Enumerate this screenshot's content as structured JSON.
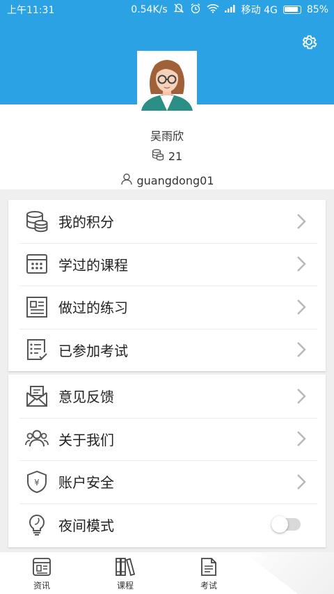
{
  "status_bar": {
    "time": "上午11:31",
    "speed": "0.54K/s",
    "carrier": "移动 4G",
    "battery": "85%"
  },
  "colors": {
    "primary": "#2aa2e3",
    "icon": "#555555",
    "chevron": "#b8b8b8"
  },
  "profile": {
    "name": "吴雨欣",
    "points": "21",
    "username": "guangdong01"
  },
  "menu_group1": [
    {
      "label": "我的积分",
      "icon": "coins-icon"
    },
    {
      "label": "学过的课程",
      "icon": "calendar-grid-icon"
    },
    {
      "label": "做过的练习",
      "icon": "newspaper-icon"
    },
    {
      "label": "已参加考试",
      "icon": "checklist-icon"
    }
  ],
  "menu_group2": [
    {
      "label": "意见反馈",
      "icon": "envelope-icon"
    },
    {
      "label": "关于我们",
      "icon": "people-icon"
    },
    {
      "label": "账户安全",
      "icon": "shield-yen-icon"
    },
    {
      "label": "夜间模式",
      "icon": "lightbulb-icon"
    }
  ],
  "night_mode": {
    "enabled": false
  },
  "tabs": [
    {
      "label": "资讯",
      "icon": "news-icon"
    },
    {
      "label": "课程",
      "icon": "books-icon"
    },
    {
      "label": "考试",
      "icon": "document-icon"
    }
  ]
}
